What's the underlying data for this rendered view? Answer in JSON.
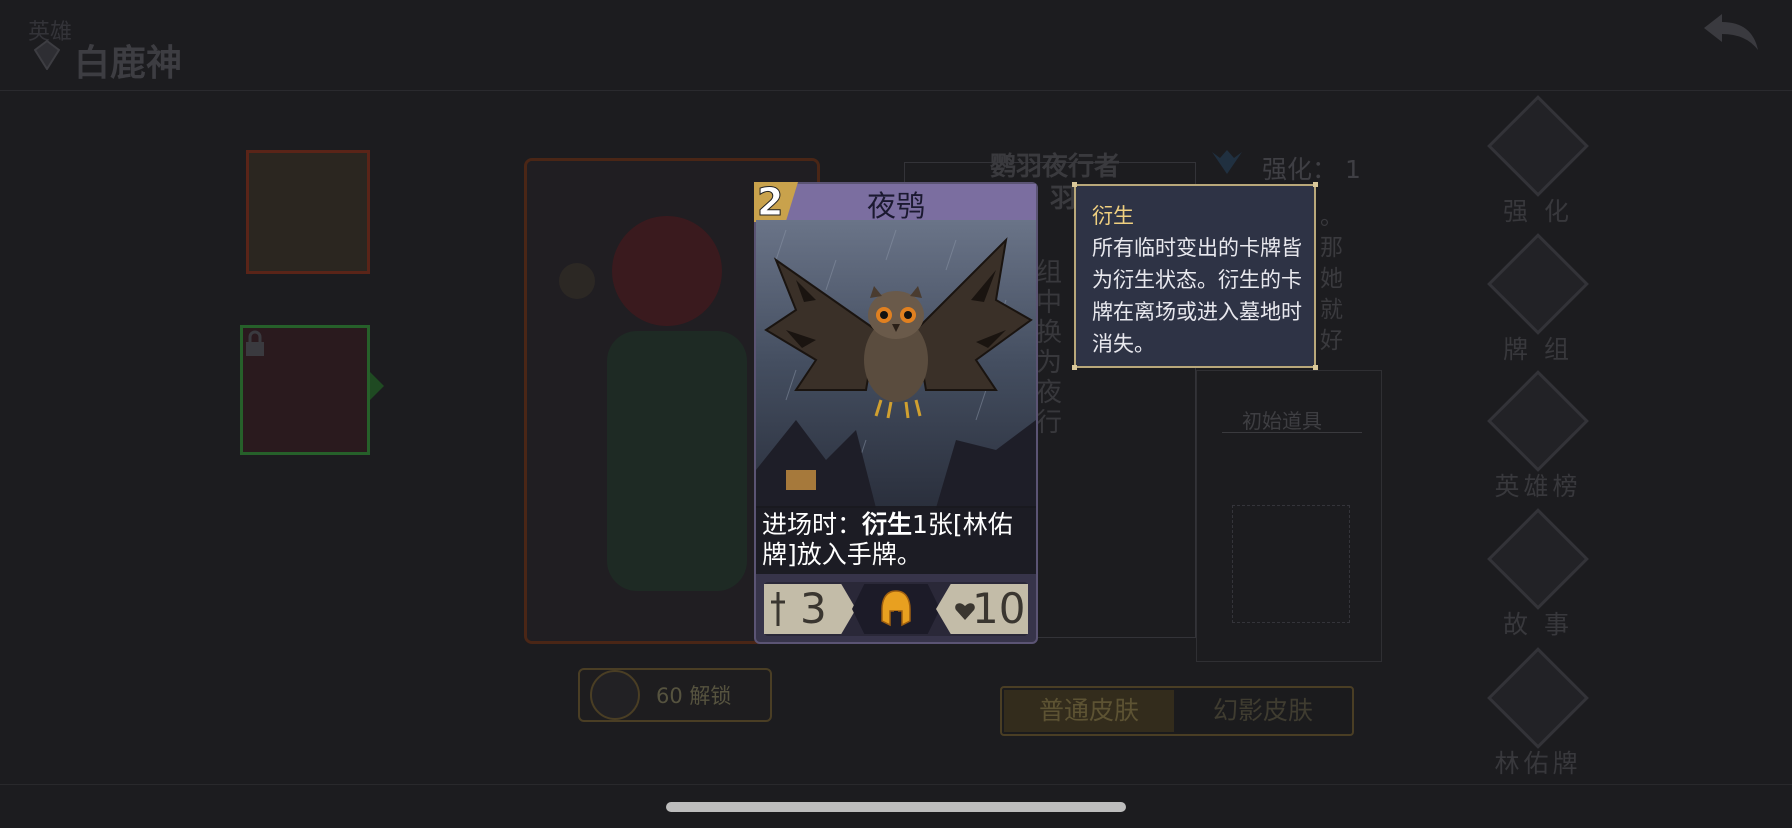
{
  "header": {
    "top_small": "英雄",
    "hero_name": "白鹿神"
  },
  "background": {
    "card_name_partial": "鹦羽夜行者",
    "card_sub_partial": "羽扰局",
    "desc_fragment": "组中 换为 夜行",
    "enhance_label": "强化：",
    "enhance_value": "1",
    "right_desc_fragment": "。 那她 就好",
    "initial_items_title": "初始道具",
    "unlock_cost": "60",
    "unlock_label": "解锁",
    "skin_tabs": [
      "普通皮肤",
      "幻影皮肤"
    ]
  },
  "nav": {
    "items": [
      {
        "label": "强 化",
        "icon": "enhance-icon"
      },
      {
        "label": "牌 组",
        "icon": "deck-icon"
      },
      {
        "label": "英雄榜",
        "icon": "ranking-icon"
      },
      {
        "label": "故 事",
        "icon": "story-icon"
      },
      {
        "label": "林佑牌",
        "icon": "lin-card-icon"
      }
    ]
  },
  "card": {
    "cost": "2",
    "name": "夜鸮",
    "text_prefix": "进场时：",
    "text_keyword": "衍生",
    "text_suffix": "1张[林佑牌]放入手牌。",
    "attack": "3",
    "health": "10",
    "type_icon": "helmet-icon"
  },
  "tooltip": {
    "title": "衍生",
    "body": "所有临时变出的卡牌皆为衍生状态。衍生的卡牌在离场或进入墓地时消失。"
  },
  "colors": {
    "tooltip_title": "#f0d080",
    "card_header": "#7b6ea0",
    "card_cost_badge": "#c9a24c"
  }
}
